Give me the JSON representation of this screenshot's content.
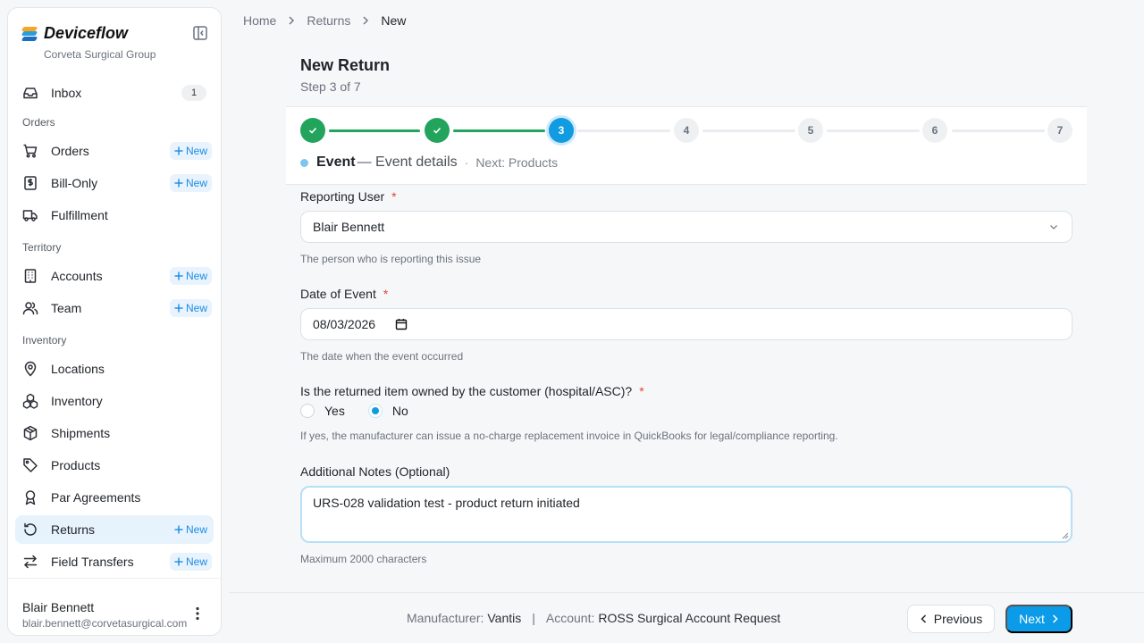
{
  "brand": {
    "name": "Deviceflow",
    "org": "Corveta Surgical Group",
    "logo_colors": [
      "#f5a623",
      "#2d9cdb",
      "#1b6fc2"
    ]
  },
  "sidebar": {
    "inbox": {
      "label": "Inbox",
      "count": "1"
    },
    "sections": [
      "Orders",
      "Territory",
      "Inventory"
    ],
    "items": [
      {
        "label": "Orders",
        "icon": "cart-icon",
        "new_label": "New"
      },
      {
        "label": "Bill-Only",
        "icon": "invoice-icon",
        "new_label": "New"
      },
      {
        "label": "Fulfillment",
        "icon": "truck-icon"
      },
      {
        "label": "Accounts",
        "icon": "building-icon",
        "new_label": "New"
      },
      {
        "label": "Team",
        "icon": "users-icon",
        "new_label": "New"
      },
      {
        "label": "Locations",
        "icon": "map-pin-icon"
      },
      {
        "label": "Inventory",
        "icon": "boxes-icon"
      },
      {
        "label": "Shipments",
        "icon": "package-icon"
      },
      {
        "label": "Products",
        "icon": "tag-icon"
      },
      {
        "label": "Par Agreements",
        "icon": "ribbon-icon"
      },
      {
        "label": "Returns",
        "icon": "rotate-ccw-icon",
        "new_label": "New",
        "active": true
      },
      {
        "label": "Field Transfers",
        "icon": "arrows-swap-icon",
        "new_label": "New"
      }
    ],
    "user": {
      "name": "Blair Bennett",
      "email": "blair.bennett@corvetasurgical.com"
    }
  },
  "breadcrumb": [
    "Home",
    "Returns",
    "New"
  ],
  "page": {
    "title": "New Return",
    "subtitle": "Step 3 of 7"
  },
  "stepper": {
    "steps": [
      "1",
      "2",
      "3",
      "4",
      "5",
      "6",
      "7"
    ],
    "current": 3,
    "current_name": "Event",
    "current_desc": "— Event details",
    "separator": "·",
    "next_text": "Next: Products"
  },
  "form": {
    "reporting_user": {
      "label": "Reporting User",
      "required": "*",
      "value": "Blair Bennett",
      "help": "The person who is reporting this issue"
    },
    "date_of_event": {
      "label": "Date of Event",
      "required": "*",
      "value": "08/03/2026",
      "help": "The date when the event occurred"
    },
    "owned": {
      "label": "Is the returned item owned by the customer (hospital/ASC)?",
      "required": "*",
      "options": [
        "Yes",
        "No"
      ],
      "selected": "No",
      "help": "If yes, the manufacturer can issue a no-charge replacement invoice in QuickBooks for legal/compliance reporting."
    },
    "notes": {
      "label": "Additional Notes (Optional)",
      "value": "URS-028 validation test - product return initiated",
      "help": "Maximum 2000 characters"
    }
  },
  "footer": {
    "manufacturer_label": "Manufacturer:",
    "manufacturer": "Vantis",
    "pipe": "|",
    "account_label": "Account:",
    "account": "ROSS Surgical Account Request",
    "previous": "Previous",
    "next": "Next"
  },
  "colors": {
    "accent": "#119be0",
    "done": "#22a45d",
    "required": "#e0443c"
  }
}
